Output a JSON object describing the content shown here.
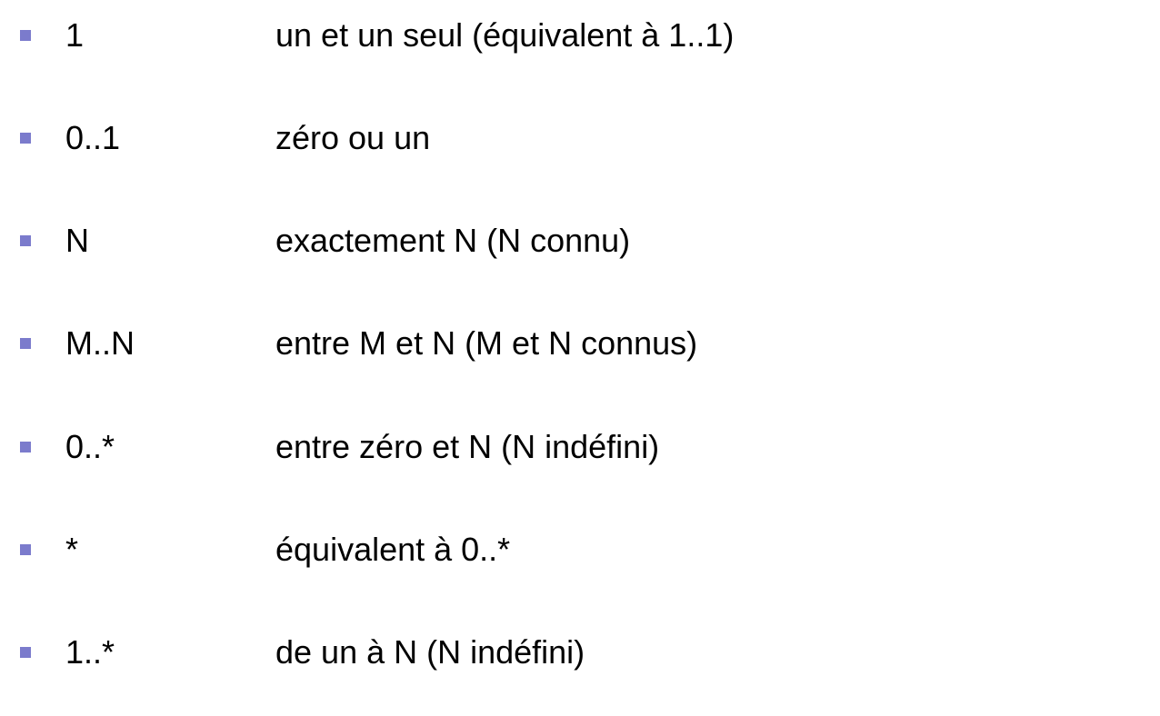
{
  "colors": {
    "bullet": "#7b7bcc",
    "text": "#000000",
    "background": "#ffffff"
  },
  "multiplicities": [
    {
      "term": "1",
      "description": "un et un seul (équivalent à 1..1)"
    },
    {
      "term": "0..1",
      "description": "zéro ou un"
    },
    {
      "term": "N",
      "description": "exactement N (N connu)"
    },
    {
      "term": "M..N",
      "description": "entre M et N (M et N connus)"
    },
    {
      "term": "0..*",
      "description": "entre zéro et N (N indéfini)"
    },
    {
      "term": "*",
      "description": "équivalent à 0..*"
    },
    {
      "term": "1..*",
      "description": "de un à N (N indéfini)"
    }
  ]
}
